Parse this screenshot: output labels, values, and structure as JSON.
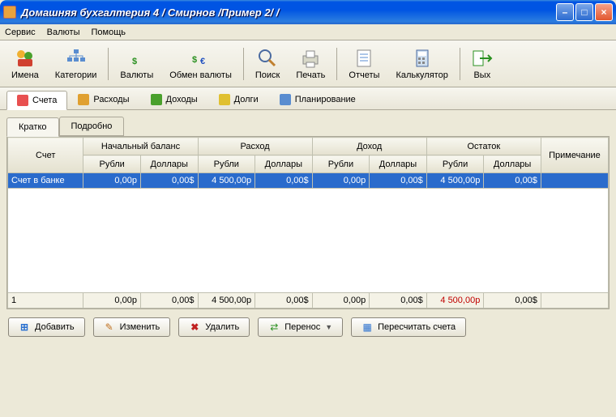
{
  "window": {
    "title": "Домашняя бухгалтерия 4  / Смирнов /Пример 2/ /"
  },
  "menu": {
    "service": "Сервис",
    "currencies": "Валюты",
    "help": "Помощь"
  },
  "toolbar": {
    "names": "Имена",
    "categories": "Категории",
    "currencies": "Валюты",
    "exchange": "Обмен валюты",
    "search": "Поиск",
    "print": "Печать",
    "reports": "Отчеты",
    "calc": "Калькулятор",
    "exit": "Вых"
  },
  "tabs": {
    "accounts": "Счета",
    "expenses": "Расходы",
    "income": "Доходы",
    "debts": "Долги",
    "planning": "Планирование"
  },
  "subtabs": {
    "brief": "Кратко",
    "detail": "Подробно"
  },
  "grid": {
    "hdr": {
      "account": "Счет",
      "start_balance": "Начальный баланс",
      "expense": "Расход",
      "income": "Доход",
      "remainder": "Остаток",
      "note": "Примечание",
      "rub": "Рубли",
      "usd": "Доллары"
    },
    "rows": [
      {
        "account": "Счет в банке",
        "start_rub": "0,00р",
        "start_usd": "0,00$",
        "exp_rub": "4 500,00р",
        "exp_usd": "0,00$",
        "inc_rub": "0,00р",
        "inc_usd": "0,00$",
        "rem_rub": "4 500,00р",
        "rem_usd": "0,00$",
        "note": ""
      }
    ],
    "total": {
      "account": "1",
      "start_rub": "0,00р",
      "start_usd": "0,00$",
      "exp_rub": "4 500,00р",
      "exp_usd": "0,00$",
      "inc_rub": "0,00р",
      "inc_usd": "0,00$",
      "rem_rub": "4 500,00р",
      "rem_usd": "0,00$",
      "note": ""
    }
  },
  "buttons": {
    "add": "Добавить",
    "edit": "Изменить",
    "delete": "Удалить",
    "transfer": "Перенос",
    "recalc": "Пересчитать счета"
  }
}
